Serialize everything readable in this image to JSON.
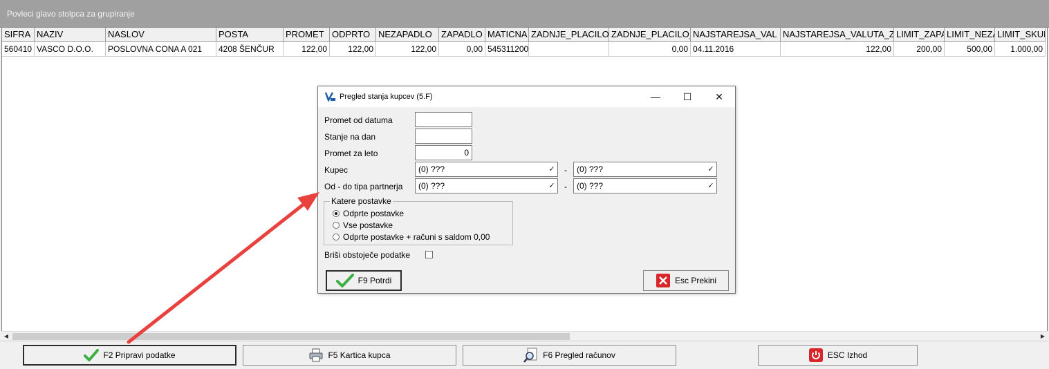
{
  "group_bar": {
    "text": "Povleci glavo stolpca za grupiranje"
  },
  "grid": {
    "columns": [
      "SIFRA",
      "NAZIV",
      "NASLOV",
      "POSTA",
      "PROMET",
      "ODPRTO",
      "NEZAPADLO",
      "ZAPADLO",
      "MATICNA",
      "ZADNJE_PLACILO",
      "ZADNJE_PLACILO_",
      "NAJSTAREJSA_VAL",
      "NAJSTAREJSA_VALUTA_Z",
      "LIMIT_ZAPA",
      "LIMIT_NEZA",
      "LIMIT_SKUP"
    ],
    "rows": [
      [
        "560410",
        "VASCO D.O.O.",
        "POSLOVNA CONA A 021",
        "4208 ŠENČUR",
        "122,00",
        "122,00",
        "122,00",
        "0,00",
        "545311200",
        "",
        "0,00",
        "04.11.2016",
        "122,00",
        "200,00",
        "500,00",
        "1.000,00"
      ]
    ]
  },
  "bottom_buttons": [
    {
      "label": "F2 Pripravi podatke",
      "icon": "green-check-icon"
    },
    {
      "label": "F5 Kartica kupca",
      "icon": "printer-icon"
    },
    {
      "label": "F6 Pregled računov",
      "icon": "magnifier-document-icon"
    },
    {
      "label": "ESC Izhod",
      "icon": "power-exit-icon"
    }
  ],
  "dialog": {
    "title": "Pregled stanja kupcev  (5.F)",
    "titlebar_buttons": {
      "minimize": "—",
      "maximize": "☐",
      "close": "✕"
    },
    "fields": {
      "promet_od_datuma": {
        "label": "Promet od datuma",
        "value": ""
      },
      "stanje_na_dan": {
        "label": "Stanje na dan",
        "value": ""
      },
      "promet_za_leto": {
        "label": "Promet za leto",
        "value": "0"
      },
      "kupec": {
        "label": "Kupec",
        "from": "(0) ???",
        "to": "(0) ???"
      },
      "tip_partnerja": {
        "label": "Od - do tipa partnerja",
        "from": "(0) ???",
        "to": "(0) ???"
      },
      "range_separator": "-"
    },
    "katere_postavke": {
      "title": "Katere postavke",
      "options": [
        "Odprte postavke",
        "Vse postavke",
        "Odprte postavke + računi s saldom 0,00"
      ],
      "selected": "Odprte postavke"
    },
    "brisi": {
      "label": "Briši obstoječe podatke",
      "checked": false
    },
    "buttons": {
      "confirm": {
        "label": "F9 Potrdi",
        "icon": "green-check-icon"
      },
      "cancel": {
        "label": "Esc Prekini",
        "icon": "red-x-icon"
      }
    }
  },
  "colors": {
    "annotation_arrow": "#e8413e",
    "group_bar": "#a0a0a0",
    "check_green": "#3cb043"
  }
}
